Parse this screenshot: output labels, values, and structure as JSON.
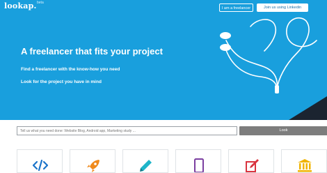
{
  "header": {
    "brand": "lookap.",
    "brand_badge": "beta",
    "freelancer_button": "I am a freelancer",
    "linkedin_button": "Join us using Linkedin"
  },
  "hero": {
    "headline": "A freelancer that fits your project",
    "line1": "Find a freelancer with the know-how you need",
    "line2": "Look for the project you have in mind"
  },
  "search": {
    "placeholder": "Tell us what you need done: Website Blog, Android app, Marketing study ...",
    "button_label": "Look"
  },
  "categories": [
    {
      "icon": "code-icon",
      "color": "#1a73c9"
    },
    {
      "icon": "rocket-icon",
      "color": "#f08a1c"
    },
    {
      "icon": "pencil-icon",
      "color": "#1fb5c9"
    },
    {
      "icon": "tablet-icon",
      "color": "#7b3fa0"
    },
    {
      "icon": "edit-icon",
      "color": "#d9343f"
    },
    {
      "icon": "bank-icon",
      "color": "#f0b400"
    }
  ],
  "colors": {
    "hero_bg": "#199fdd",
    "search_button": "#7d7d7d"
  }
}
